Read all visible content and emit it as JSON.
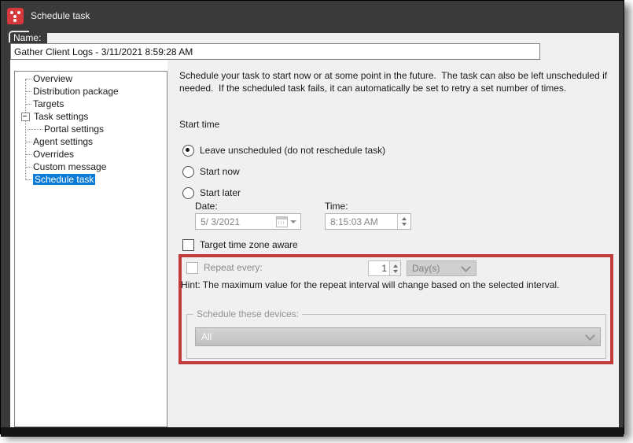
{
  "window": {
    "title": "Schedule task",
    "icon": "ivanti-app-icon"
  },
  "name_field": {
    "label": "Name:",
    "value": "Gather Client Logs - 3/11/2021 8:59:28 AM"
  },
  "tree": {
    "items": [
      {
        "label": "Overview"
      },
      {
        "label": "Distribution package"
      },
      {
        "label": "Targets"
      },
      {
        "label": "Task settings",
        "expanded": true
      },
      {
        "label": "Portal settings",
        "child": true
      },
      {
        "label": "Agent settings"
      },
      {
        "label": "Overrides"
      },
      {
        "label": "Custom message"
      },
      {
        "label": "Schedule task",
        "selected": true
      }
    ]
  },
  "panel": {
    "description": "Schedule your task to start now or at some point in the future.  The task can also be left unscheduled if needed.  If the scheduled task fails, it can automatically be set to retry a set number of times.",
    "start_time_label": "Start time",
    "radios": [
      {
        "label": "Leave unscheduled (do not reschedule task)",
        "selected": true
      },
      {
        "label": "Start now",
        "selected": false
      },
      {
        "label": "Start later",
        "selected": false
      }
    ],
    "date": {
      "label": "Date:",
      "value": "5/ 3/2021",
      "disabled": true
    },
    "time": {
      "label": "Time:",
      "value": "8:15:03 AM",
      "disabled": true
    },
    "timezone_checkbox": {
      "label": "Target time zone aware",
      "checked": false
    },
    "repeat": {
      "checkbox_label": "Repeat every:",
      "checked": false,
      "interval_value": "1",
      "interval_unit": "Day(s)",
      "hint": "Hint: The maximum value for the repeat interval will change based on the selected interval.",
      "disabled": true
    },
    "devices_group": {
      "label": "Schedule these devices:",
      "selected_option": "All",
      "disabled": true
    }
  },
  "colors": {
    "titlebar": "#3a3a3a",
    "brand_red": "#d6393c",
    "annotation_red": "#c23b3b",
    "selection_blue": "#0a7bd6",
    "panel_gray": "#f0f0f0",
    "disabled_text": "#8a8a8a"
  }
}
